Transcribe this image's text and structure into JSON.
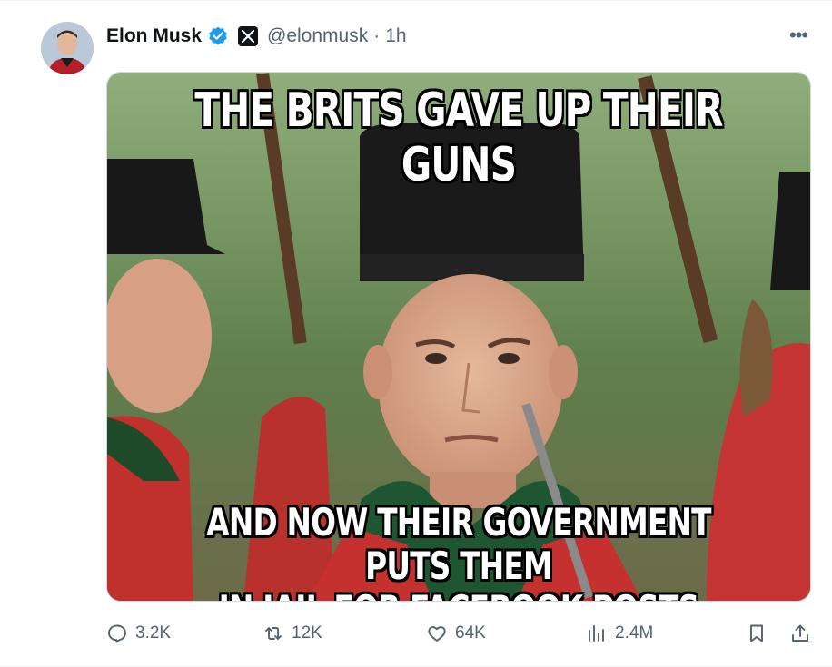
{
  "author": {
    "name": "Elon Musk",
    "handle": "@elonmusk",
    "separator": "·",
    "time": "1h",
    "verified_icon": "verified-badge-icon",
    "affiliation_icon": "x-logo-icon"
  },
  "menu": {
    "more_label": "•••"
  },
  "media": {
    "top_caption": "THE BRITS GAVE UP THEIR GUNS",
    "bottom_caption_line1": "AND NOW THEIR GOVERNMENT PUTS THEM",
    "bottom_caption_line2": "IN JAIL FOR FACEBOOK POSTS"
  },
  "actions": {
    "replies": "3.2K",
    "reposts": "12K",
    "likes": "64K",
    "views": "2.4M"
  },
  "colors": {
    "verified": "#1d9bf0",
    "muted": "#536471",
    "text": "#0f1419"
  }
}
